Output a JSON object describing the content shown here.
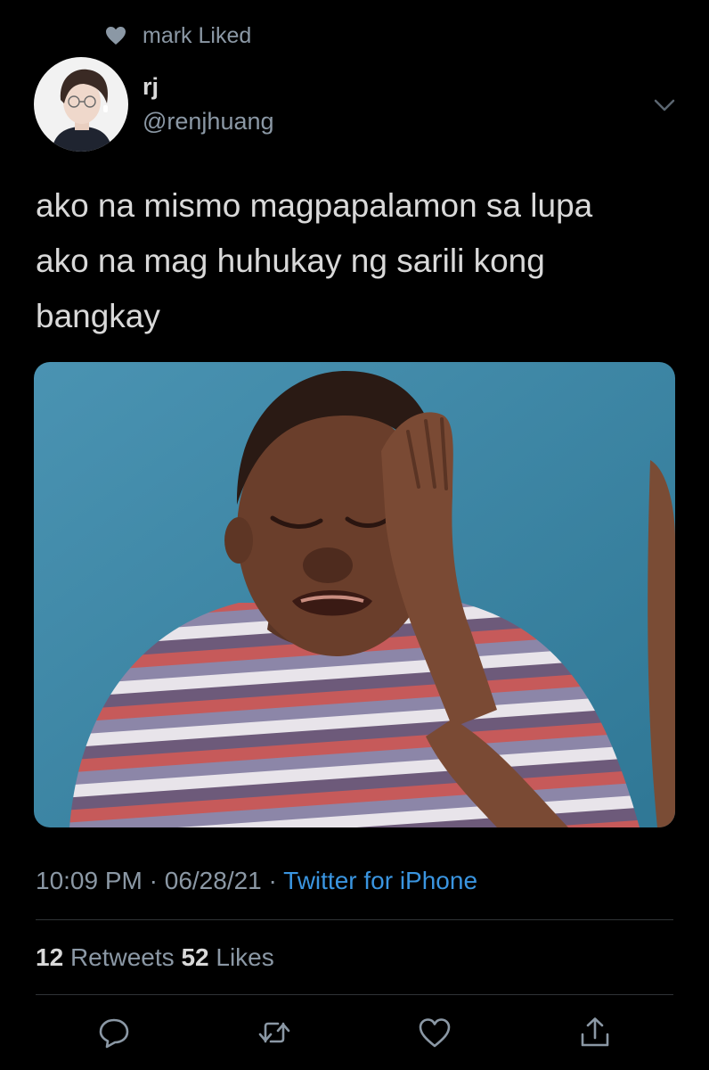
{
  "social_context": {
    "icon": "heart-icon",
    "text": "mark Liked"
  },
  "author": {
    "avatar_icon": "avatar",
    "display_name": "rj",
    "handle": "@renjhuang"
  },
  "menu": {
    "icon": "chevron-down-icon"
  },
  "tweet": {
    "lines": [
      "ako na mismo magpapalamon sa lupa",
      "ako na mag huhukay ng sarili kong",
      "bangkay"
    ]
  },
  "media": {
    "type": "image",
    "colors": {
      "background": "#3f8aa8",
      "shirt_stripes": [
        "#c65a5a",
        "#8c86a8",
        "#e8e4ea",
        "#6d5a7a"
      ]
    }
  },
  "meta": {
    "time": "10:09 PM",
    "separator": "·",
    "date": "06/28/21",
    "source": "Twitter for iPhone"
  },
  "stats": {
    "retweets_count": "12",
    "retweets_label": "Retweets",
    "likes_count": "52",
    "likes_label": "Likes"
  },
  "actions": [
    {
      "name": "reply",
      "icon": "comment-icon"
    },
    {
      "name": "retweet",
      "icon": "retweet-icon"
    },
    {
      "name": "like",
      "icon": "heart-icon"
    },
    {
      "name": "share",
      "icon": "share-icon"
    }
  ],
  "colors": {
    "background": "#000000",
    "text_primary": "#d9d9d9",
    "text_secondary": "#8b98a5",
    "link": "#3a95e0",
    "divider": "#2f3336"
  }
}
